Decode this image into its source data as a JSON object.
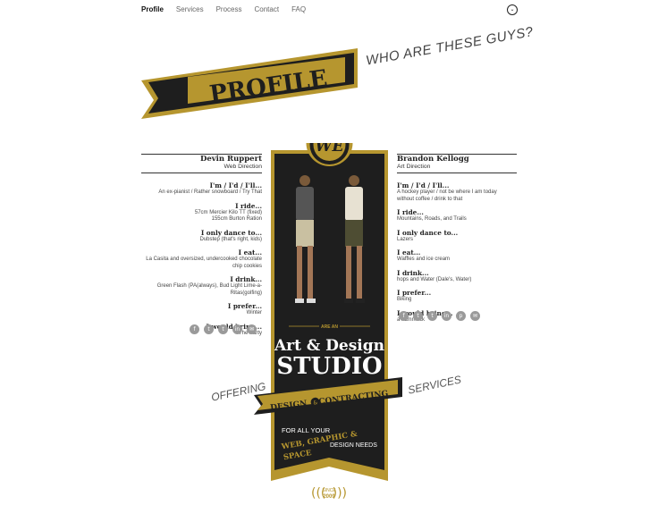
{
  "nav": {
    "items": [
      "Profile",
      "Services",
      "Process",
      "Contact",
      "FAQ"
    ],
    "active": "Profile",
    "toggle_icon": "chevron-down-icon"
  },
  "banner": {
    "title": "PROFILE",
    "tagline": "WHO ARE THESE GUYS?"
  },
  "colors": {
    "gold": "#b6962f",
    "dark": "#1e1e1e",
    "paper": "#fff"
  },
  "left": {
    "name": "Devin Ruppert",
    "role": "Web Direction",
    "rows": [
      {
        "h": "I'm / I'd / I'll...",
        "t": "An ex-pianist / Rather snowboard / Try That"
      },
      {
        "h": "I ride...",
        "t": "57cm Mercier Kilo TT (fixed) 155cm Burton Ration"
      },
      {
        "h": "I only dance to...",
        "t": "Dubstep (that's right, kids)"
      },
      {
        "h": "I eat...",
        "t": "La Casita and oversized, undercooked chocolate chip cookies"
      },
      {
        "h": "I drink...",
        "t": "Green Flash (PA(always), Bud Light Lime-a-Ritas(golfing)"
      },
      {
        "h": "I prefer...",
        "t": "Winter"
      },
      {
        "h": "I would bring...",
        "t": "The Party"
      }
    ]
  },
  "right": {
    "name": "Brandon Kellogg",
    "role": "Art Direction",
    "rows": [
      {
        "h": "I'm / I'd / I'll...",
        "t": "A hockey player / not be where I am today without coffee / drink to that"
      },
      {
        "h": "I ride...",
        "t": "Mountains, Roads, and Trails"
      },
      {
        "h": "I only dance to...",
        "t": "Lazers"
      },
      {
        "h": "I eat...",
        "t": "Waffles and ice cream"
      },
      {
        "h": "I drink...",
        "t": "hops and Water (Dale's, Water)"
      },
      {
        "h": "I prefer...",
        "t": "Biking"
      },
      {
        "h": "I would bring...",
        "t": "a hammock"
      }
    ]
  },
  "card": {
    "badge": "WE",
    "are_an": "ARE AN",
    "title1": "Art & Design",
    "title2": "STUDIO",
    "ribbon_left": "DESIGN",
    "ribbon_amp": "&",
    "ribbon_right": "CONTRACTING",
    "for_all": "FOR ALL YOUR",
    "needs_gold1": "WEB, GRAPHIC &",
    "needs_gold2": "SPACE",
    "needs_tail": "DESIGN NEEDS",
    "since": "SINCE",
    "year": "2009"
  },
  "offering": "OFFERING",
  "services": "SERVICES",
  "social_icons": [
    "facebook-icon",
    "twitter-icon",
    "tumblr-icon",
    "linkedin-icon",
    "email-icon"
  ],
  "social_icons_right": [
    "facebook-icon",
    "twitter-icon",
    "tumblr-icon",
    "linkedin-icon",
    "pinterest-icon",
    "email-icon"
  ]
}
